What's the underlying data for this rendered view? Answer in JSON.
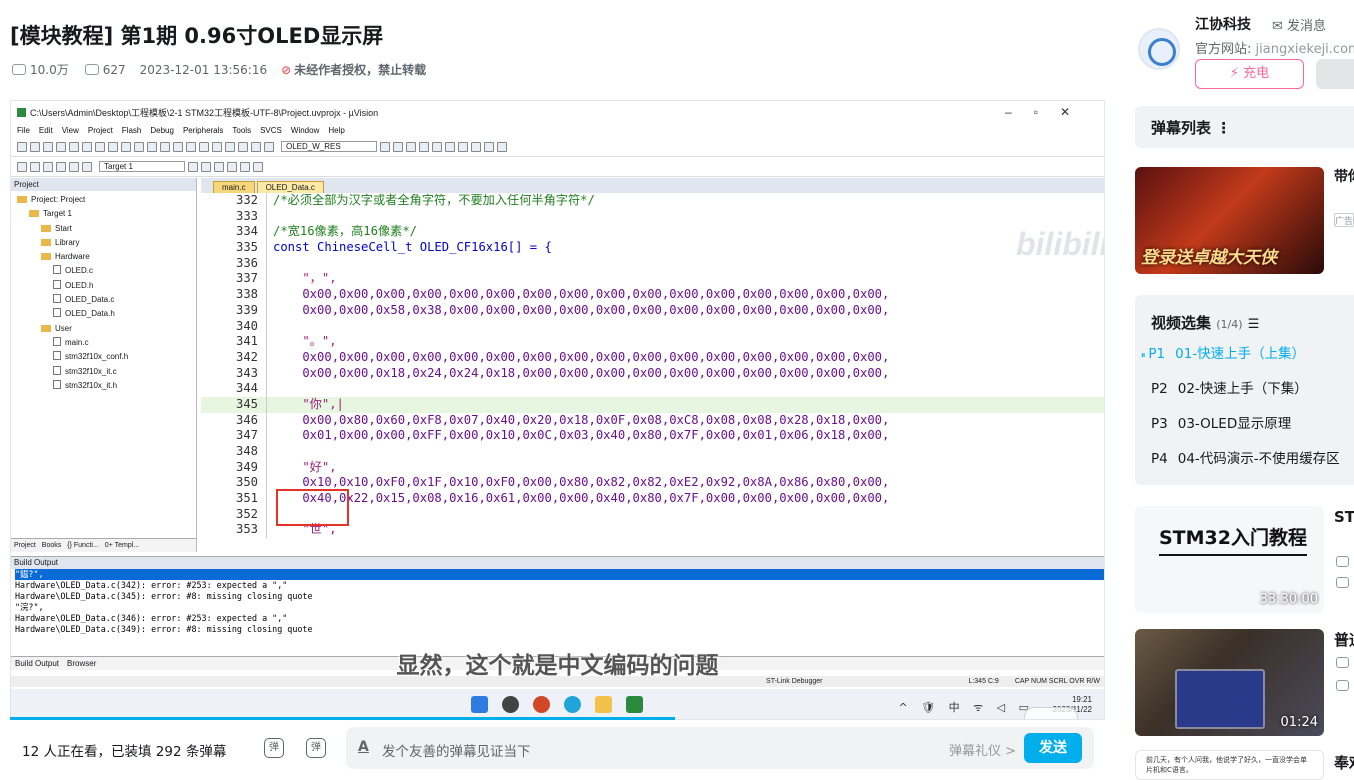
{
  "title": "[模块教程] 第1期 0.96寸OLED显示屏",
  "meta": {
    "views": "10.0万",
    "danmaku": "627",
    "date": "2023-12-01 13:56:16",
    "warning": "未经作者授权，禁止转载"
  },
  "ide": {
    "window_title": "C:\\Users\\Admin\\Desktop\\工程模板\\2-1 STM32工程模板-UTF-8\\Project.uvprojx - µVision",
    "menus": [
      "File",
      "Edit",
      "View",
      "Project",
      "Flash",
      "Debug",
      "Peripherals",
      "Tools",
      "SVCS",
      "Window",
      "Help"
    ],
    "target_select": "OLED_W_RES",
    "target": "Target 1",
    "project_header": "Project",
    "tree": [
      {
        "label": "Project: Project",
        "depth": 0,
        "kind": "folder"
      },
      {
        "label": "Target 1",
        "depth": 1,
        "kind": "folder"
      },
      {
        "label": "Start",
        "depth": 2,
        "kind": "folder"
      },
      {
        "label": "Library",
        "depth": 2,
        "kind": "folder"
      },
      {
        "label": "Hardware",
        "depth": 2,
        "kind": "folder"
      },
      {
        "label": "OLED.c",
        "depth": 3,
        "kind": "file"
      },
      {
        "label": "OLED.h",
        "depth": 3,
        "kind": "file"
      },
      {
        "label": "OLED_Data.c",
        "depth": 3,
        "kind": "file"
      },
      {
        "label": "OLED_Data.h",
        "depth": 3,
        "kind": "file"
      },
      {
        "label": "User",
        "depth": 2,
        "kind": "folder"
      },
      {
        "label": "main.c",
        "depth": 3,
        "kind": "file"
      },
      {
        "label": "stm32f10x_conf.h",
        "depth": 3,
        "kind": "file"
      },
      {
        "label": "stm32f10x_it.c",
        "depth": 3,
        "kind": "file"
      },
      {
        "label": "stm32f10x_it.h",
        "depth": 3,
        "kind": "file"
      }
    ],
    "project_tabs": [
      "Project",
      "Books",
      "{} Functi...",
      "0+ Templ..."
    ],
    "editor_tabs": [
      "main.c",
      "OLED_Data.c"
    ],
    "code": [
      {
        "n": "332",
        "t": "/*必须全部为汉字或者全角字符，不要加入任何半角字符*/",
        "c": "cm"
      },
      {
        "n": "333",
        "t": "",
        "c": ""
      },
      {
        "n": "334",
        "t": "/*宽16像素，高16像素*/",
        "c": "cm"
      },
      {
        "n": "335",
        "t": "const ChineseCell_t OLED_CF16x16[] = {",
        "c": "kw"
      },
      {
        "n": "336",
        "t": "",
        "c": ""
      },
      {
        "n": "337",
        "t": "    \"，\",",
        "c": "st"
      },
      {
        "n": "338",
        "t": "    0x00,0x00,0x00,0x00,0x00,0x00,0x00,0x00,0x00,0x00,0x00,0x00,0x00,0x00,0x00,0x00,",
        "c": "hx"
      },
      {
        "n": "339",
        "t": "    0x00,0x00,0x58,0x38,0x00,0x00,0x00,0x00,0x00,0x00,0x00,0x00,0x00,0x00,0x00,0x00,",
        "c": "hx"
      },
      {
        "n": "340",
        "t": "",
        "c": ""
      },
      {
        "n": "341",
        "t": "    \"。\",",
        "c": "st"
      },
      {
        "n": "342",
        "t": "    0x00,0x00,0x00,0x00,0x00,0x00,0x00,0x00,0x00,0x00,0x00,0x00,0x00,0x00,0x00,0x00,",
        "c": "hx"
      },
      {
        "n": "343",
        "t": "    0x00,0x00,0x18,0x24,0x24,0x18,0x00,0x00,0x00,0x00,0x00,0x00,0x00,0x00,0x00,0x00,",
        "c": "hx"
      },
      {
        "n": "344",
        "t": "",
        "c": ""
      },
      {
        "n": "345",
        "t": "    \"你\",|",
        "c": "st hl"
      },
      {
        "n": "346",
        "t": "    0x00,0x80,0x60,0xF8,0x07,0x40,0x20,0x18,0x0F,0x08,0xC8,0x08,0x08,0x28,0x18,0x00,",
        "c": "hx"
      },
      {
        "n": "347",
        "t": "    0x01,0x00,0x00,0xFF,0x00,0x10,0x0C,0x03,0x40,0x80,0x7F,0x00,0x01,0x06,0x18,0x00,",
        "c": "hx"
      },
      {
        "n": "348",
        "t": "",
        "c": ""
      },
      {
        "n": "349",
        "t": "    \"好\",",
        "c": "st"
      },
      {
        "n": "350",
        "t": "    0x10,0x10,0xF0,0x1F,0x10,0xF0,0x00,0x80,0x82,0x82,0xE2,0x92,0x8A,0x86,0x80,0x00,",
        "c": "hx"
      },
      {
        "n": "351",
        "t": "    0x40,0x22,0x15,0x08,0x16,0x61,0x00,0x00,0x40,0x80,0x7F,0x00,0x00,0x00,0x00,0x00,",
        "c": "hx"
      },
      {
        "n": "352",
        "t": "",
        "c": ""
      },
      {
        "n": "353",
        "t": "    \"世\",",
        "c": "st"
      }
    ],
    "build_header": "Build Output",
    "build_lines": [
      {
        "t": "    \"鎾?\",",
        "sel": true
      },
      {
        "t": "Hardware\\OLED_Data.c(342): error:  #253: expected a \",\"",
        "sel": false
      },
      {
        "t": "Hardware\\OLED_Data.c(345): error:  #8: missing closing quote",
        "sel": false
      },
      {
        "t": "    \"浣?\",",
        "sel": false
      },
      {
        "t": "Hardware\\OLED_Data.c(346): error:  #253: expected a \",\"",
        "sel": false
      },
      {
        "t": "Hardware\\OLED_Data.c(349): error:  #8: missing closing quote",
        "sel": false
      }
    ],
    "build_tabs": [
      "Build Output",
      "Browser"
    ],
    "status": {
      "debugger": "ST-Link Debugger",
      "pos": "L:345 C:9",
      "flags": "CAP  NUM  SCRL  OVR  R/W"
    },
    "tray": {
      "ime": "^ 🛡 中 ᯤ ◁ ▭",
      "time": "19:21",
      "date": "2023/11/22"
    }
  },
  "subtitle": "显然，这个就是中文编码的问题",
  "watermark": "bilibili",
  "bottom": {
    "viewers_pre": "12",
    "viewers_mid": " 人正在看，已装填 ",
    "viewers_num": "292",
    "viewers_post": " 条弹幕",
    "dm_on": "弹",
    "dm_set": "弹",
    "placeholder": "发个友善的弹幕见证当下",
    "etiquette": "弹幕礼仪 >",
    "send": "发送",
    "input_icon": "A"
  },
  "author": {
    "name": "江协科技",
    "message": "发消息",
    "site_label": "官方网站: ",
    "site_url": "jiangxiekeji.com",
    "charge": "⚡ 充电"
  },
  "danmaku_list": "弹幕列表  ⋮",
  "ad": {
    "banner": "登录送卓越大天侠",
    "title": "带你再现",
    "tag": "广告"
  },
  "episodes": {
    "header": "视频选集",
    "count": "(1/4)",
    "items": [
      {
        "no": "P1",
        "title": "01-快速上手（上集）",
        "current": true
      },
      {
        "no": "P2",
        "title": "02-快速上手（下集）",
        "current": false
      },
      {
        "no": "P3",
        "title": "03-OLED显示原理",
        "current": false
      },
      {
        "no": "P4",
        "title": "04-代码演示-不使用缓存区",
        "current": false
      }
    ]
  },
  "related": [
    {
      "thumb_text": "STM32入门教程",
      "duration": "33:30:00",
      "title": "ST讲解"
    },
    {
      "duration": "01:24",
      "title": "普通"
    },
    {
      "thumb_text": "前几天，有个人问我，他说学了好久，一直没学会单片机和C语言。",
      "title": "奉劝"
    }
  ],
  "colors": {
    "accent": "#00aeec",
    "pink": "#ff6699",
    "warn": "#f25d59"
  }
}
